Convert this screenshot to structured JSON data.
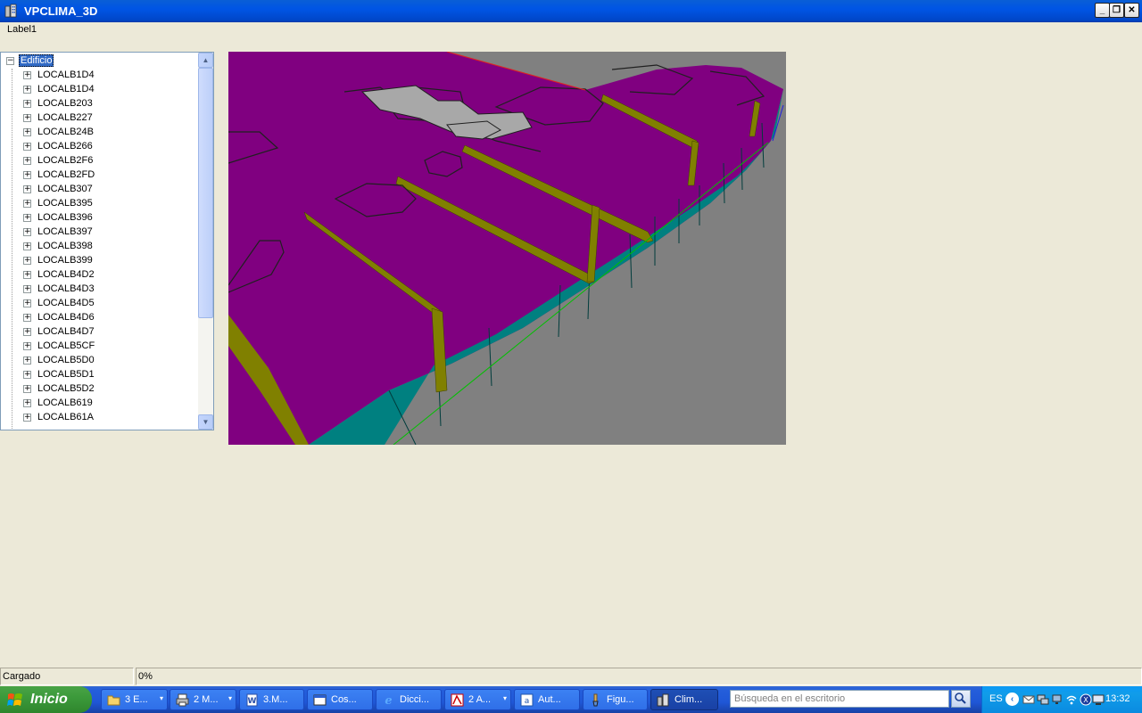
{
  "window": {
    "title": "VPCLIMA_3D",
    "min_glyph": "_",
    "restore_glyph": "❐",
    "close_glyph": "✕"
  },
  "label1": "Label1",
  "tree": {
    "root_label": "Edificio",
    "root_expander": "−",
    "item_expander": "+",
    "items": [
      "LOCALB1D4",
      "LOCALB1D4",
      "LOCALB203",
      "LOCALB227",
      "LOCALB24B",
      "LOCALB266",
      "LOCALB2F6",
      "LOCALB2FD",
      "LOCALB307",
      "LOCALB395",
      "LOCALB396",
      "LOCALB397",
      "LOCALB398",
      "LOCALB399",
      "LOCALB4D2",
      "LOCALB4D3",
      "LOCALB4D5",
      "LOCALB4D6",
      "LOCALB4D7",
      "LOCALB5CF",
      "LOCALB5D0",
      "LOCALB5D1",
      "LOCALB5D2",
      "LOCALB619",
      "LOCALB61A"
    ],
    "scroll_up": "▲",
    "scroll_down": "▼"
  },
  "viewport": {
    "colors": {
      "roof": "#800080",
      "wall": "#008080",
      "edge": "#808000",
      "ground": "#808080",
      "patio": "#a8a8a8"
    }
  },
  "status": {
    "left": "Cargado",
    "right": "0%"
  },
  "taskbar": {
    "start_label": "Inicio",
    "buttons": [
      {
        "label": "3 E...",
        "icon": "folder-icon",
        "arrow": "▾"
      },
      {
        "label": "2 M...",
        "icon": "printer-icon",
        "arrow": "▾"
      },
      {
        "label": "3.M...",
        "icon": "word-document-icon",
        "arrow": ""
      },
      {
        "label": "Cos...",
        "icon": "window-icon",
        "arrow": ""
      },
      {
        "label": "Dicci...",
        "icon": "internet-explorer-icon",
        "arrow": ""
      },
      {
        "label": "2 A...",
        "icon": "acrobat-icon",
        "arrow": "▾"
      },
      {
        "label": "Aut...",
        "icon": "autocad-icon",
        "arrow": ""
      },
      {
        "label": "Figu...",
        "icon": "paint-icon",
        "arrow": ""
      },
      {
        "label": "Clim...",
        "icon": "building-icon",
        "arrow": ""
      }
    ],
    "search_placeholder": "Búsqueda en el escritorio",
    "language": "ES",
    "tray_arrow": "‹",
    "clock": "13:32"
  }
}
